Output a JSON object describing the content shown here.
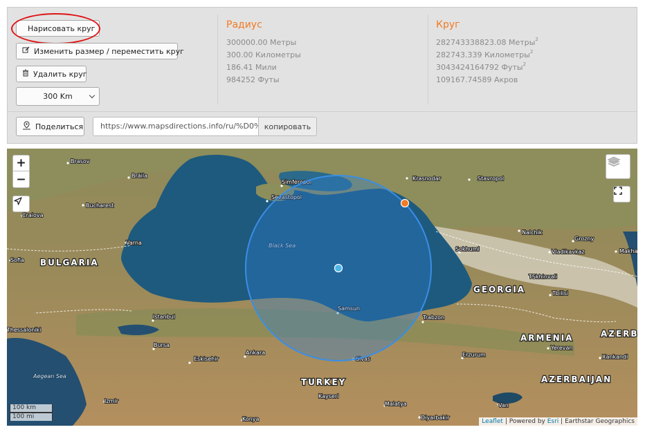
{
  "controls": {
    "draw_label": "Нарисовать круг",
    "resize_label": "Изменить размер / переместить круг",
    "delete_label": "Удалить круг",
    "radius_select_value": "300 Km"
  },
  "radius": {
    "title": "Радиус",
    "meters": "300000.00 Метры",
    "kilometers": "300.00 Километры",
    "miles": "186.41 Мили",
    "feet": "984252 Футы"
  },
  "circle": {
    "title": "Круг",
    "area_m": "282743338823.08 Метры",
    "area_km": "282743.339 Километры",
    "area_ft": "3043424164792 Футы",
    "area_acres": "109167.74589 Акров",
    "sup": "2"
  },
  "share": {
    "label": "Поделиться",
    "url": "https://www.mapsdirections.info/ru/%D0%",
    "copy_label": "копировать"
  },
  "map": {
    "zoom_in": "+",
    "zoom_out": "−",
    "sea_label": "Black Sea",
    "aegean_label": "Aegean Sea",
    "countries": {
      "bulgaria": "BULGARIA",
      "georgia": "GEORGIA",
      "turkey": "TURKEY",
      "armenia": "ARMENIA",
      "azerbaijan": "AZERBAIJAN",
      "azerb": "AZERB"
    },
    "cities": {
      "brasov": "Brasov",
      "braila": "Brăila",
      "bucharest": "Bucharest",
      "craiova": "Craiova",
      "varna": "Varna",
      "sofia": "Sofia",
      "simferopol": "Simferopol",
      "sevastopol": "Sevastopol",
      "krasnodar": "Krasnodar",
      "stavropol": "Stavropol",
      "nalchik": "Nalchik",
      "grozny": "Grozny",
      "vladikavkaz": "Vladikavkaz",
      "makha": "Makha",
      "sokhumi": "Sokhumi",
      "tskhinvali": "TSkhinvali",
      "tbilisi": "Tbilisi",
      "samsun": "Samsun",
      "trabzon": "Trabzon",
      "istanbul": "Istanbul",
      "thessaloniki": "Thessaloniki",
      "bursa": "Bursa",
      "eskisehir": "Eskisehir",
      "ankara": "Ankara",
      "sivas": "Sivas",
      "erzurum": "Erzurum",
      "yerevan": "Yerevan",
      "xankandi": "Xankandi",
      "kayseri": "Kayseri",
      "izmir": "Izmir",
      "malatya": "Malatya",
      "van": "Van",
      "konya": "Konya",
      "diyarbakir": "Diyarbakir"
    },
    "scale_km": "100 km",
    "scale_mi": "100 mi",
    "attribution": {
      "leaflet": "Leaflet",
      "powered_by": " | Powered by ",
      "esri": "Esri",
      "rest": " | Earthstar Geographics"
    }
  },
  "colors": {
    "accent_orange": "#f07a22",
    "annotation_red": "#e01414",
    "circle_fill": "#2a7fd4",
    "sea": "#1e5a7e"
  }
}
